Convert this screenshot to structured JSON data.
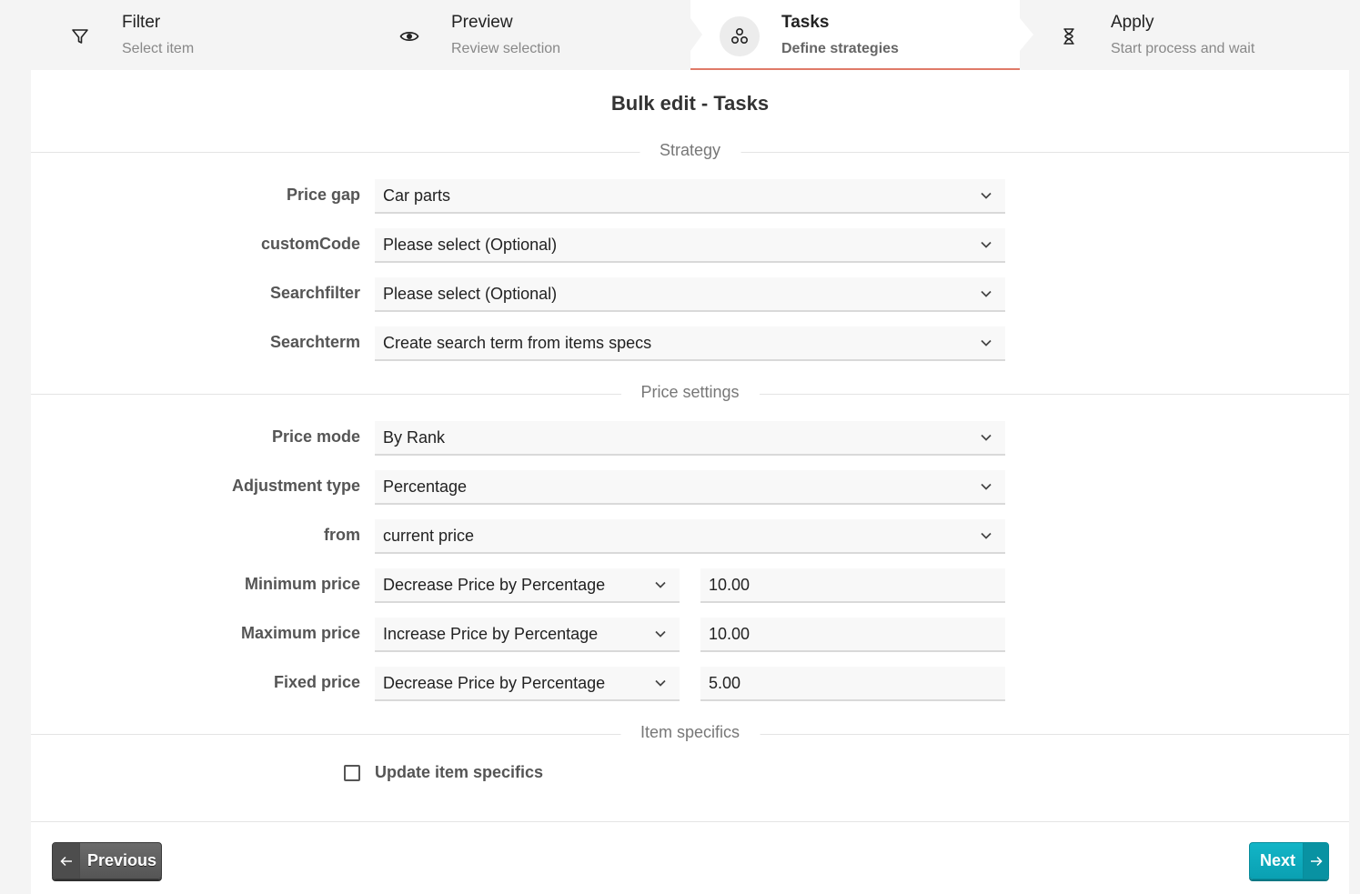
{
  "steps": [
    {
      "title": "Filter",
      "subtitle": "Select item",
      "icon": "filter-icon"
    },
    {
      "title": "Preview",
      "subtitle": "Review selection",
      "icon": "eye-icon"
    },
    {
      "title": "Tasks",
      "subtitle": "Define strategies",
      "icon": "tasks-icon",
      "active": true
    },
    {
      "title": "Apply",
      "subtitle": "Start process and wait",
      "icon": "hourglass-icon"
    }
  ],
  "card": {
    "title": "Bulk edit - Tasks"
  },
  "sections": {
    "strategy": "Strategy",
    "price_settings": "Price settings",
    "item_specifics": "Item specifics"
  },
  "strategy": {
    "price_gap": {
      "label": "Price gap",
      "value": "Car parts"
    },
    "custom_code": {
      "label": "customCode",
      "value": "Please select (Optional)"
    },
    "searchfilter": {
      "label": "Searchfilter",
      "value": "Please select (Optional)"
    },
    "searchterm": {
      "label": "Searchterm",
      "value": "Create search term from items specs"
    }
  },
  "price": {
    "mode": {
      "label": "Price mode",
      "value": "By Rank"
    },
    "adjustment_type": {
      "label": "Adjustment type",
      "value": "Percentage"
    },
    "from": {
      "label": "from",
      "value": "current price"
    },
    "minimum": {
      "label": "Minimum price",
      "mode": "Decrease Price by Percentage",
      "amount": "10.00"
    },
    "maximum": {
      "label": "Maximum price",
      "mode": "Increase Price by Percentage",
      "amount": "10.00"
    },
    "fixed": {
      "label": "Fixed price",
      "mode": "Decrease Price by Percentage",
      "amount": "5.00"
    }
  },
  "item_specifics": {
    "checkbox_label": "Update item specifics",
    "checked": false
  },
  "buttons": {
    "previous": "Previous",
    "next": "Next"
  },
  "colors": {
    "active_step_underline": "#e07a68",
    "next_button": "#0aa0b2",
    "previous_button": "#555555"
  }
}
